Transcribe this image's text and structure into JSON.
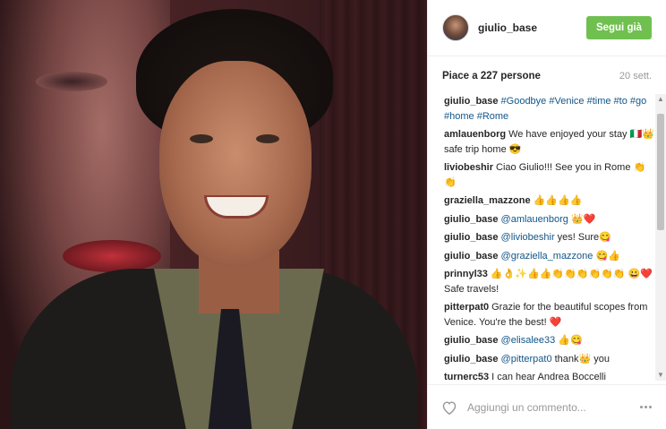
{
  "post": {
    "image_alt": "giulio_base photo"
  },
  "header": {
    "username": "giulio_base",
    "follow_label": "Segui già"
  },
  "meta": {
    "likes": "Piace a 227 persone",
    "date": "20 sett."
  },
  "comments": [
    {
      "user": "giulio_base",
      "parts": [
        {
          "t": "tag",
          "v": "#Goodbye"
        },
        {
          "t": "text",
          "v": " "
        },
        {
          "t": "tag",
          "v": "#Venice"
        },
        {
          "t": "text",
          "v": " "
        },
        {
          "t": "tag",
          "v": "#time"
        },
        {
          "t": "text",
          "v": " "
        },
        {
          "t": "tag",
          "v": "#to"
        },
        {
          "t": "text",
          "v": " "
        },
        {
          "t": "tag",
          "v": "#go"
        },
        {
          "t": "text",
          "v": " "
        },
        {
          "t": "tag",
          "v": "#home"
        },
        {
          "t": "text",
          "v": " "
        },
        {
          "t": "tag",
          "v": "#Rome"
        }
      ]
    },
    {
      "user": "amlauenborg",
      "parts": [
        {
          "t": "text",
          "v": "We have enjoyed your stay 🇮🇹👑 safe trip home 😎"
        }
      ]
    },
    {
      "user": "liviobeshir",
      "parts": [
        {
          "t": "text",
          "v": "Ciao Giulio!!! See you in Rome 👏👏"
        }
      ]
    },
    {
      "user": "graziella_mazzone",
      "parts": [
        {
          "t": "text",
          "v": "👍👍👍👍"
        }
      ]
    },
    {
      "user": "giulio_base",
      "parts": [
        {
          "t": "tag",
          "v": "@amlauenborg"
        },
        {
          "t": "text",
          "v": " 👑❤️"
        }
      ]
    },
    {
      "user": "giulio_base",
      "parts": [
        {
          "t": "tag",
          "v": "@liviobeshir"
        },
        {
          "t": "text",
          "v": " yes! Sure😋"
        }
      ]
    },
    {
      "user": "giulio_base",
      "parts": [
        {
          "t": "tag",
          "v": "@graziella_mazzone"
        },
        {
          "t": "text",
          "v": " 😋👍"
        }
      ]
    },
    {
      "user": "prinnyl33",
      "parts": [
        {
          "t": "text",
          "v": "👍👌✨👍👍👏👏👏👏👏👏 😀❤️ Safe travels!"
        }
      ]
    },
    {
      "user": "pitterpat0",
      "parts": [
        {
          "t": "text",
          "v": "Grazie for the beautiful scopes from Venice. You're the best! ❤️"
        }
      ]
    },
    {
      "user": "giulio_base",
      "parts": [
        {
          "t": "tag",
          "v": "@elisalee33"
        },
        {
          "t": "text",
          "v": " 👍😋"
        }
      ]
    },
    {
      "user": "giulio_base",
      "parts": [
        {
          "t": "tag",
          "v": "@pitterpat0"
        },
        {
          "t": "text",
          "v": " thank👑 you"
        }
      ]
    },
    {
      "user": "turnerc53",
      "parts": [
        {
          "t": "text",
          "v": "I can hear Andrea Boccelli"
        }
      ]
    }
  ],
  "footer": {
    "comment_placeholder": "Aggiungi un commento..."
  },
  "icons": {
    "heart": "heart-icon",
    "more": "more-options-icon"
  },
  "colors": {
    "follow_button": "#70c050",
    "hashtag": "#125688"
  }
}
